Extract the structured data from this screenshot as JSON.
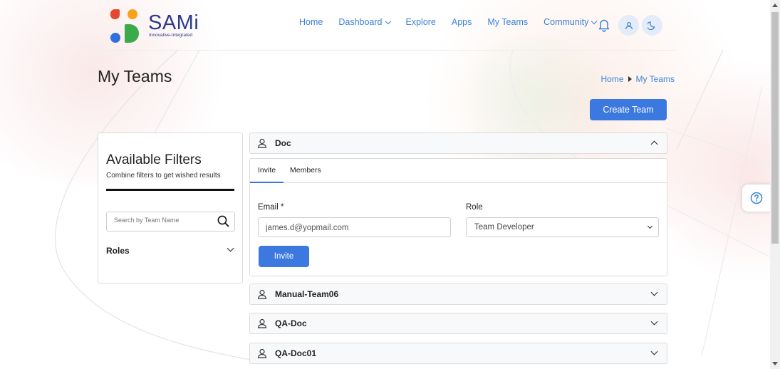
{
  "brand": {
    "name": "SAMi",
    "tagline": "Innovative-Integrated",
    "colors": {
      "red": "#e8472f",
      "orange": "#f7a21b",
      "blue": "#2f6fe0",
      "green": "#3aaa4a",
      "text": "#2c3a8c"
    }
  },
  "nav": {
    "items": [
      {
        "label": "Home",
        "has_dropdown": false
      },
      {
        "label": "Dashboard",
        "has_dropdown": true
      },
      {
        "label": "Explore",
        "has_dropdown": false
      },
      {
        "label": "Apps",
        "has_dropdown": false
      },
      {
        "label": "My Teams",
        "has_dropdown": false
      },
      {
        "label": "Community",
        "has_dropdown": true
      }
    ],
    "icons": [
      "bell-icon",
      "user-icon",
      "moon-icon"
    ]
  },
  "page": {
    "title": "My Teams",
    "breadcrumb": [
      "Home",
      "My Teams"
    ],
    "create_button": "Create Team"
  },
  "filters": {
    "title": "Available Filters",
    "subtitle": "Combine filters to get wished results",
    "search_placeholder": "Search by Team Name",
    "roles_label": "Roles"
  },
  "teams": [
    {
      "name": "Doc",
      "expanded": true
    },
    {
      "name": "Manual-Team06",
      "expanded": false
    },
    {
      "name": "QA-Doc",
      "expanded": false
    },
    {
      "name": "QA-Doc01",
      "expanded": false
    }
  ],
  "invite_panel": {
    "tabs": [
      "Invite",
      "Members"
    ],
    "active_tab": "Invite",
    "email_label": "Email *",
    "email_value": "james.d@yopmail.com",
    "role_label": "Role",
    "role_value": "Team Developer",
    "invite_button": "Invite"
  },
  "accent_color": "#3b78e0"
}
